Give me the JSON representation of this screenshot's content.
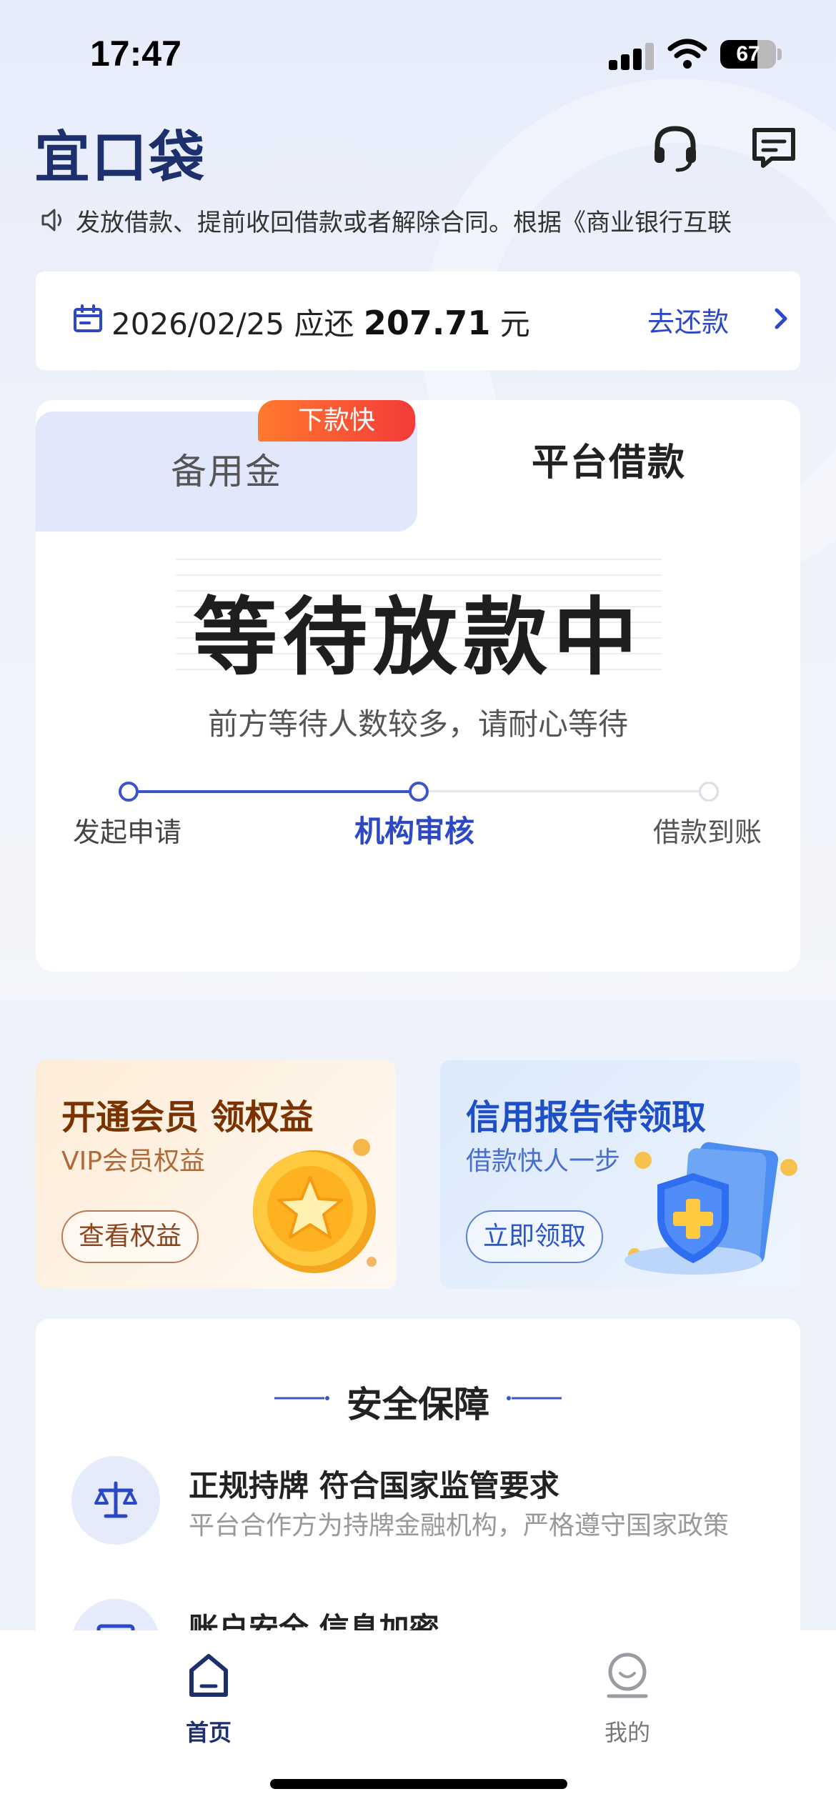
{
  "status_bar": {
    "time": "17:47",
    "battery": "67",
    "battery_level": 0.67
  },
  "header": {
    "logo": "宜口袋",
    "icons": [
      "headset-icon",
      "message-icon"
    ]
  },
  "notice": {
    "icon": "speaker-icon",
    "text": "发放借款、提前收回借款或者解除合同。根据《商业银行互联"
  },
  "repay": {
    "icon": "calendar-icon",
    "date": "2026/02/25",
    "label": "应还",
    "amount": "207.71",
    "unit": "元",
    "action": "去还款"
  },
  "loan_card": {
    "tabs": [
      {
        "label": "备用金",
        "selected": false
      },
      {
        "label": "平台借款",
        "selected": true
      }
    ],
    "badge": "下款快",
    "status_title": "等待放款中",
    "status_subtitle": "前方等待人数较多，请耐心等待",
    "steps": [
      {
        "label": "发起申请",
        "state": "done"
      },
      {
        "label": "机构审核",
        "state": "active"
      },
      {
        "label": "借款到账",
        "state": "pending"
      }
    ]
  },
  "promos": [
    {
      "title": "开通会员 领权益",
      "subtitle": "VIP会员权益",
      "button": "查看权益",
      "art": "gold-star-coin-icon"
    },
    {
      "title": "信用报告待领取",
      "subtitle": "借款快人一步",
      "button": "立即领取",
      "art": "blue-shield-report-icon"
    }
  ],
  "safety": {
    "title": "安全保障",
    "items": [
      {
        "icon": "scale-icon",
        "title": "正规持牌 符合国家监管要求",
        "desc": "平台合作方为持牌金融机构，严格遵守国家政策"
      },
      {
        "icon": "lock-icon",
        "title": "账户安全 信息加密",
        "desc": ""
      }
    ]
  },
  "tabbar": [
    {
      "label": "首页",
      "icon": "home-icon",
      "active": true
    },
    {
      "label": "我的",
      "icon": "profile-icon",
      "active": false
    }
  ],
  "colors": {
    "accent": "#2c48c7",
    "badge_start": "#ff7a2e",
    "badge_end": "#f43a3a",
    "logo": "#1d2f6c"
  }
}
